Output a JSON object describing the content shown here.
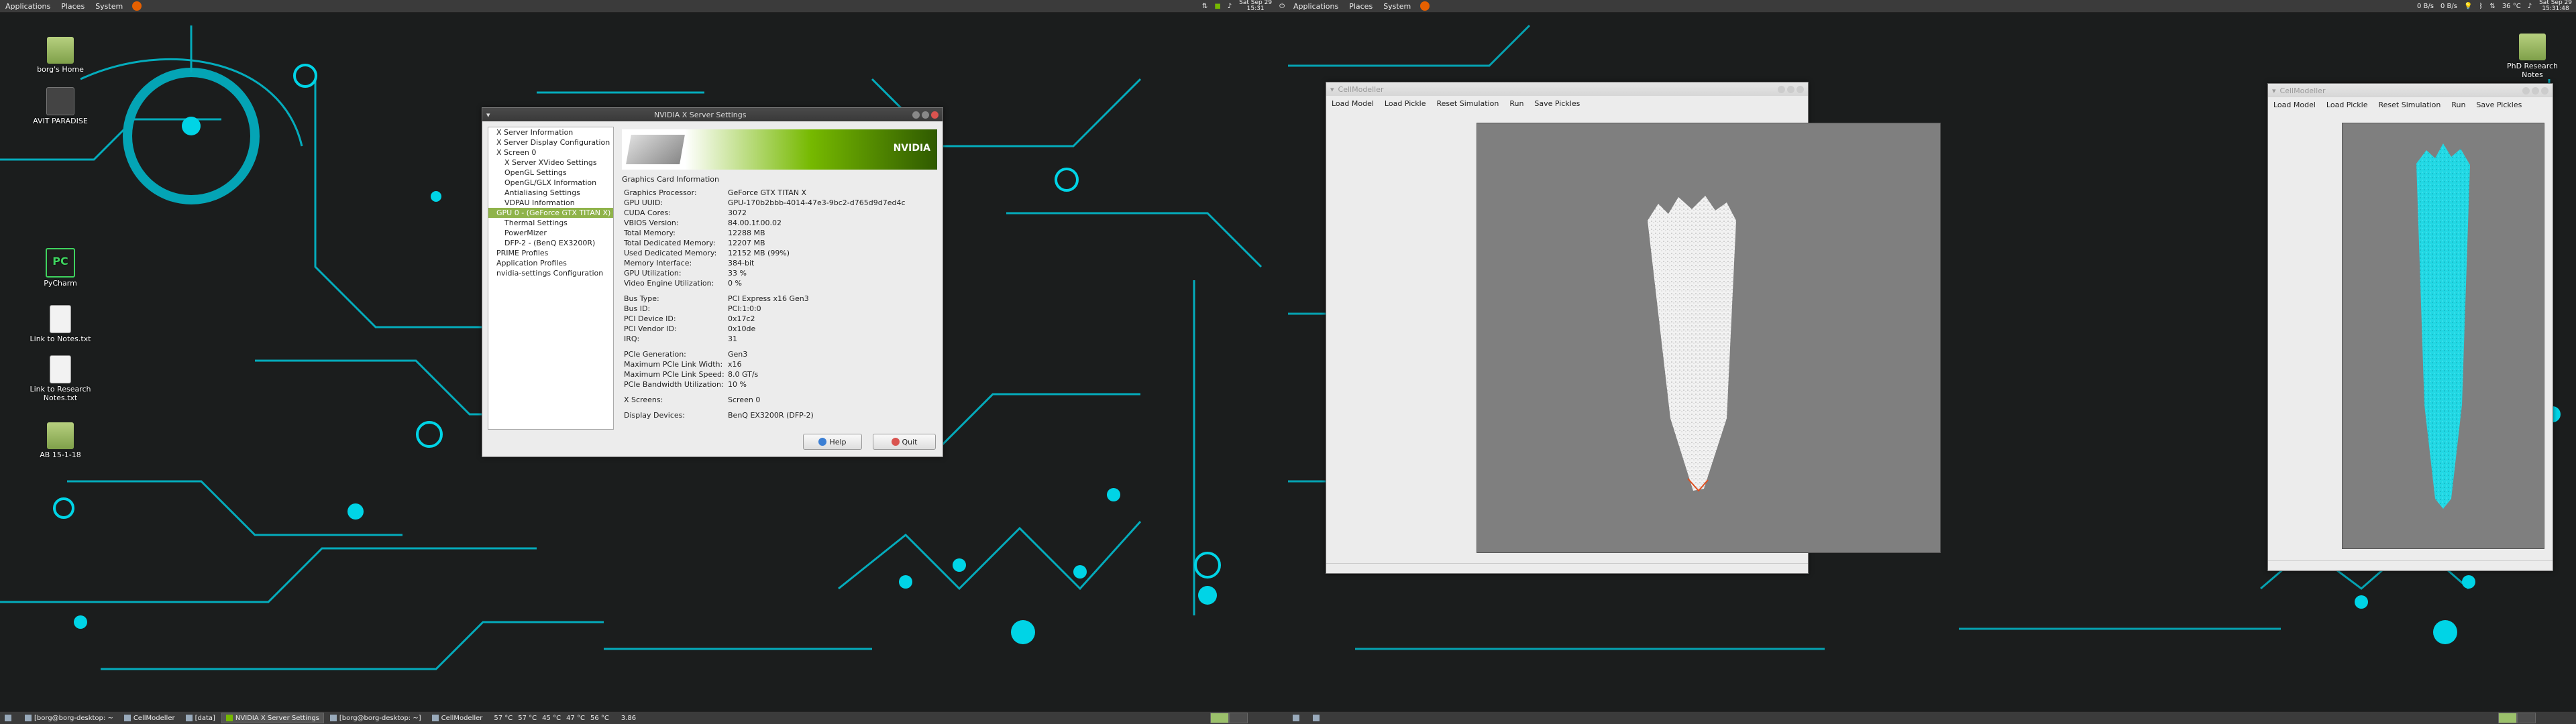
{
  "left_panel": {
    "menus": [
      "Applications",
      "Places",
      "System"
    ],
    "clock": {
      "line1": "Sat Sep 29",
      "line2": "15:31"
    }
  },
  "right_panel": {
    "menus": [
      "Applications",
      "Places",
      "System"
    ],
    "tray": {
      "net1": "0 B/s",
      "net2": "0 B/s",
      "temp": "36 °C"
    },
    "clock": {
      "line1": "Sat Sep 29",
      "line2": "15:31:48"
    }
  },
  "desktop_left": {
    "icons": [
      {
        "label": "borg's Home"
      },
      {
        "label": "AVIT PARADISE"
      },
      {
        "label": "PyCharm"
      },
      {
        "label": "Link to Notes.txt"
      },
      {
        "label": "Link to Research Notes.txt"
      },
      {
        "label": "AB 15-1-18"
      }
    ]
  },
  "desktop_right": {
    "icons": [
      {
        "label": "PhD Research Notes"
      }
    ]
  },
  "taskbar_left": {
    "tasks": [
      {
        "label": "[borg@borg-desktop: ~"
      },
      {
        "label": "CellModeller"
      },
      {
        "label": "[data]"
      },
      {
        "label": "NVIDIA X Server Settings"
      },
      {
        "label": "[borg@borg-desktop: ~]"
      },
      {
        "label": "CellModeller"
      }
    ],
    "temps": [
      "57 °C",
      "57 °C",
      "45 °C",
      "47 °C",
      "56 °C"
    ],
    "load": "3.86"
  },
  "nvidia": {
    "title": "NVIDIA X Server Settings",
    "tree": [
      "X Server Information",
      "X Server Display Configuration",
      "X Screen 0",
      "X Server XVideo Settings",
      "OpenGL Settings",
      "OpenGL/GLX Information",
      "Antialiasing Settings",
      "VDPAU Information",
      "GPU 0 - (GeForce GTX TITAN X)",
      "Thermal Settings",
      "PowerMizer",
      "DFP-2 - (BenQ EX3200R)",
      "PRIME Profiles",
      "Application Profiles",
      "nvidia-settings Configuration"
    ],
    "logo_text": "NVIDIA",
    "section_title": "Graphics Card Information",
    "rows1": [
      {
        "k": "Graphics Processor:",
        "v": "GeForce GTX TITAN X"
      },
      {
        "k": "GPU UUID:",
        "v": "GPU-170b2bbb-4014-47e3-9bc2-d765d9d7ed4c"
      },
      {
        "k": "CUDA Cores:",
        "v": "3072"
      },
      {
        "k": "VBIOS Version:",
        "v": "84.00.1f.00.02"
      },
      {
        "k": "Total Memory:",
        "v": "12288 MB"
      },
      {
        "k": "Total Dedicated Memory:",
        "v": "12207 MB"
      },
      {
        "k": "Used Dedicated Memory:",
        "v": "12152 MB (99%)"
      },
      {
        "k": "Memory Interface:",
        "v": "384-bit"
      },
      {
        "k": "GPU Utilization:",
        "v": "33 %"
      },
      {
        "k": "Video Engine Utilization:",
        "v": "0 %"
      }
    ],
    "rows2": [
      {
        "k": "Bus Type:",
        "v": "PCI Express x16 Gen3"
      },
      {
        "k": "Bus ID:",
        "v": "PCI:1:0:0"
      },
      {
        "k": "PCI Device ID:",
        "v": "0x17c2"
      },
      {
        "k": "PCI Vendor ID:",
        "v": "0x10de"
      },
      {
        "k": "IRQ:",
        "v": "31"
      }
    ],
    "rows3": [
      {
        "k": "PCIe Generation:",
        "v": "Gen3"
      },
      {
        "k": "Maximum PCIe Link Width:",
        "v": "x16"
      },
      {
        "k": "Maximum PCIe Link Speed:",
        "v": "8.0 GT/s"
      },
      {
        "k": "PCIe Bandwidth Utilization:",
        "v": "10 %"
      }
    ],
    "rows4": [
      {
        "k": "X Screens:",
        "v": "Screen 0"
      }
    ],
    "rows5": [
      {
        "k": "Display Devices:",
        "v": "BenQ EX3200R (DFP-2)"
      }
    ],
    "help_label": "Help",
    "quit_label": "Quit"
  },
  "cellmodeller_menu": [
    "Load Model",
    "Load Pickle",
    "Reset Simulation",
    "Run",
    "Save Pickles"
  ],
  "cm_left": {
    "title": "CellModeller"
  },
  "cm_right": {
    "title": "CellModeller"
  },
  "colors": {
    "accent": "#00d4e6",
    "nvidia_green": "#76b900",
    "cells_white": "#f2f2f2",
    "cells_cyan": "#22d8e4"
  }
}
